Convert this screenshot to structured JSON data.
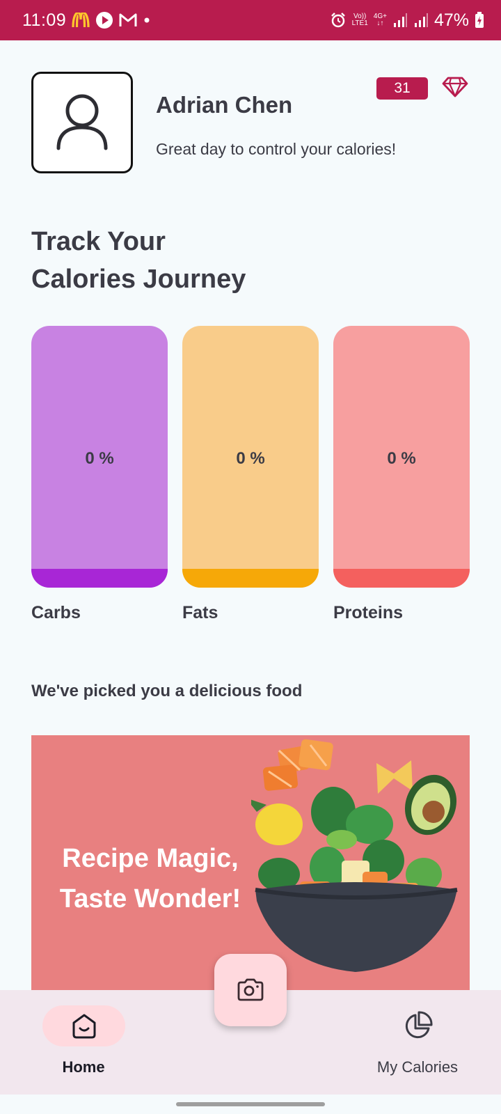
{
  "status_bar": {
    "time": "11:09",
    "battery": "47%",
    "net_top": "Vo))",
    "net_bottom": "LTE1",
    "gen_top": "4G+",
    "gen_bottom": "↓↑"
  },
  "profile": {
    "name": "Adrian Chen",
    "subtitle": "Great day to control your calories!",
    "badge_count": "31"
  },
  "heading": {
    "line1": "Track Your",
    "line2": "Calories Journey"
  },
  "macros": [
    {
      "label": "Carbs",
      "percent_text": "0 %",
      "percent": 0,
      "bg": "#c882e2",
      "fill": "#a826d6"
    },
    {
      "label": "Fats",
      "percent_text": "0 %",
      "percent": 0,
      "bg": "#f9cc8a",
      "fill": "#f6a808"
    },
    {
      "label": "Proteins",
      "percent_text": "0 %",
      "percent": 0,
      "bg": "#f79f9f",
      "fill": "#f4605e"
    }
  ],
  "recommendation": {
    "title": "We've picked you a delicious food",
    "banner_line1": "Recipe Magic,",
    "banner_line2": "Taste Wonder!"
  },
  "bottom_nav": {
    "home_label": "Home",
    "calories_label": "My Calories"
  },
  "colors": {
    "accent": "#b81c4e",
    "banner_bg": "#e88080",
    "nav_bg": "#f2e7ee",
    "pill": "#ffd9de"
  }
}
